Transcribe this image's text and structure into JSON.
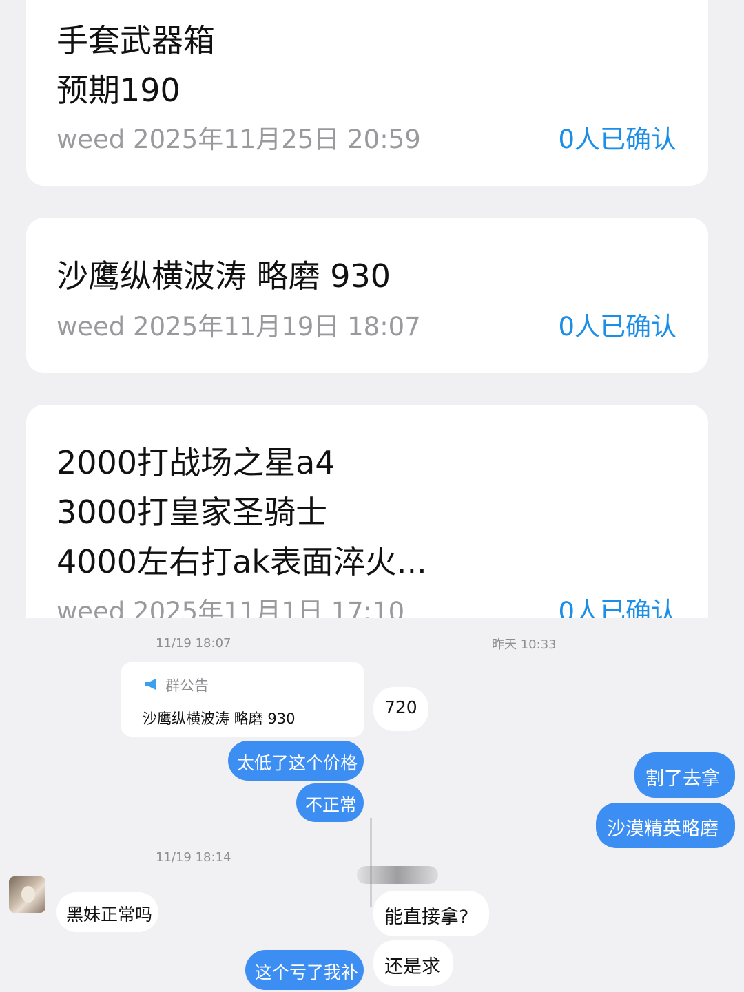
{
  "notices": [
    {
      "lines": [
        "手套武器箱",
        "预期190"
      ],
      "meta": "weed 2025年11月25日 20:59",
      "confirm": "0人已确认"
    },
    {
      "lines": [
        "沙鹰纵横波涛 略磨 930"
      ],
      "meta": "weed 2025年11月19日 18:07",
      "confirm": "0人已确认"
    },
    {
      "lines": [
        "2000打战场之星a4",
        "3000打皇家圣骑士",
        "4000左右打ak表面淬火..."
      ],
      "meta": "weed 2025年11月1日 17:10",
      "confirm": "0人已确认"
    }
  ],
  "chat_left": {
    "timestamp1": "11/19 18:07",
    "announcement": {
      "icon": "megaphone-icon",
      "title": "群公告",
      "text": "沙鹰纵横波涛 略磨 930"
    },
    "msg_too_low": "太低了这个价格",
    "msg_abnormal": "不正常",
    "timestamp2": "11/19 18:14",
    "msg_heimei": "黑妹正常吗",
    "msg_compensate": "这个亏了我补"
  },
  "chat_right": {
    "timestamp": "昨天 10:33",
    "msg_720": "720",
    "msg_cut": "割了去拿",
    "msg_desert": "沙漠精英略磨",
    "msg_direct": "能直接拿?",
    "msg_ask": "还是求"
  },
  "colors": {
    "accent_blue": "#1b8ee8",
    "bubble_blue": "#3d8ef3",
    "meta_gray": "#9a9a9e"
  }
}
